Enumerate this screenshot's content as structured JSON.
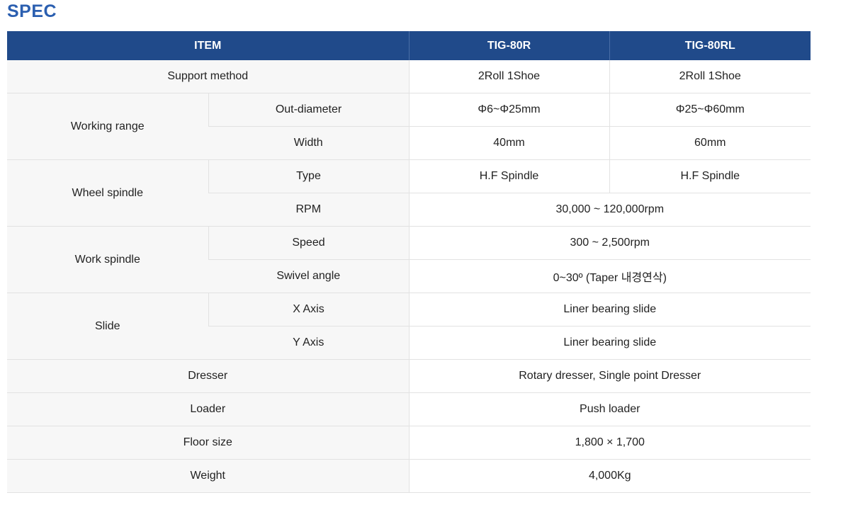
{
  "page_title": "SPEC",
  "header": {
    "item": "ITEM",
    "model_a": "TIG-80R",
    "model_b": "TIG-80RL"
  },
  "rows": {
    "support_method": {
      "label": "Support method",
      "a": "2Roll 1Shoe",
      "b": "2Roll 1Shoe"
    },
    "working_range": {
      "label": "Working range",
      "out_diameter": {
        "label": "Out-diameter",
        "a": "Φ6~Φ25mm",
        "b": "Φ25~Φ60mm"
      },
      "width": {
        "label": "Width",
        "a": "40mm",
        "b": "60mm"
      }
    },
    "wheel_spindle": {
      "label": "Wheel spindle",
      "type": {
        "label": "Type",
        "a": "H.F Spindle",
        "b": "H.F Spindle"
      },
      "rpm": {
        "label": "RPM",
        "value": "30,000 ~ 120,000rpm"
      }
    },
    "work_spindle": {
      "label": "Work spindle",
      "speed": {
        "label": "Speed",
        "value": "300 ~ 2,500rpm"
      },
      "swivel_angle": {
        "label": "Swivel angle",
        "value": "0~30º (Taper 내경연삭)"
      }
    },
    "slide": {
      "label": "Slide",
      "x_axis": {
        "label": "X Axis",
        "value": "Liner bearing slide"
      },
      "y_axis": {
        "label": "Y Axis",
        "value": "Liner bearing slide"
      }
    },
    "dresser": {
      "label": "Dresser",
      "value": "Rotary dresser, Single point Dresser"
    },
    "loader": {
      "label": "Loader",
      "value": "Push loader"
    },
    "floor_size": {
      "label": "Floor size",
      "value": "1,800 × 1,700"
    },
    "weight": {
      "label": "Weight",
      "value": "4,000Kg"
    }
  },
  "colors": {
    "title": "#2b5fb0",
    "header_bg": "#204a8a",
    "label_bg": "#f7f7f7",
    "border": "#e2e2e2"
  }
}
